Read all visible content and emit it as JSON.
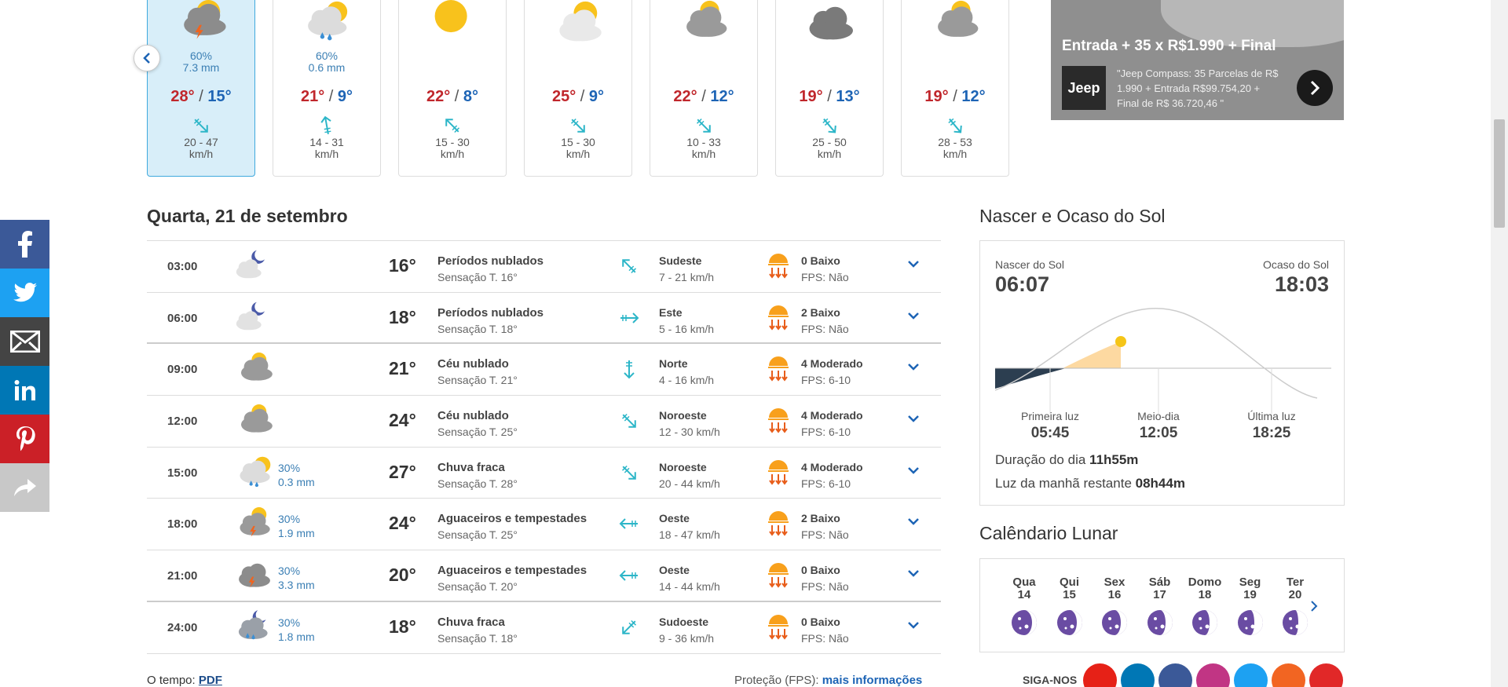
{
  "forecast_days": [
    {
      "rain_prob": "60%",
      "rain_mm": "7.3 mm",
      "max": "28°",
      "min": "15°",
      "wind": "20 - 47",
      "unit": "km/h",
      "icon": "thunderstorm-icon"
    },
    {
      "rain_prob": "60%",
      "rain_mm": "0.6 mm",
      "max": "21°",
      "min": "9°",
      "wind": "14 - 31",
      "unit": "km/h",
      "icon": "sun-rain-icon"
    },
    {
      "rain_prob": "",
      "rain_mm": "",
      "max": "22°",
      "min": "8°",
      "wind": "15 - 30",
      "unit": "km/h",
      "icon": "sun-icon"
    },
    {
      "rain_prob": "",
      "rain_mm": "",
      "max": "25°",
      "min": "9°",
      "wind": "15 - 30",
      "unit": "km/h",
      "icon": "sun-cloud-icon"
    },
    {
      "rain_prob": "",
      "rain_mm": "",
      "max": "22°",
      "min": "12°",
      "wind": "10 - 33",
      "unit": "km/h",
      "icon": "cloudy-icon"
    },
    {
      "rain_prob": "",
      "rain_mm": "",
      "max": "19°",
      "min": "13°",
      "wind": "25 - 50",
      "unit": "km/h",
      "icon": "overcast-icon"
    },
    {
      "rain_prob": "",
      "rain_mm": "",
      "max": "19°",
      "min": "12°",
      "wind": "28 - 53",
      "unit": "km/h",
      "icon": "cloudy-icon"
    }
  ],
  "ad": {
    "headline": "Entrada + 35 x R$1.990 + Final",
    "logo": "Jeep",
    "text": "\"Jeep Compass: 35 Parcelas de R$ 1.990 + Entrada R$99.754,20 + Final de R$ 36.720,46 \""
  },
  "day_title": "Quarta, 21 de setembro",
  "hours": [
    {
      "time": "03:00",
      "prob": "",
      "mm": "",
      "temp": "16°",
      "cond": "Períodos nublados",
      "feel": "Sensação T. 16°",
      "wind_dir": "Sudeste",
      "wind": "7 - 21 km/h",
      "uv": "0 Baixo",
      "fps": "FPS: Não",
      "icon": "night-cloud-icon"
    },
    {
      "time": "06:00",
      "prob": "",
      "mm": "",
      "temp": "18°",
      "cond": "Períodos nublados",
      "feel": "Sensação T. 18°",
      "wind_dir": "Este",
      "wind": "5 - 16 km/h",
      "uv": "2 Baixo",
      "fps": "FPS: Não",
      "icon": "night-cloud-icon"
    },
    {
      "time": "09:00",
      "prob": "",
      "mm": "",
      "temp": "21°",
      "cond": "Céu nublado",
      "feel": "Sensação T. 21°",
      "wind_dir": "Norte",
      "wind": "4 - 16 km/h",
      "uv": "4 Moderado",
      "fps": "FPS: 6-10",
      "icon": "cloudy-icon"
    },
    {
      "time": "12:00",
      "prob": "",
      "mm": "",
      "temp": "24°",
      "cond": "Céu nublado",
      "feel": "Sensação T. 25°",
      "wind_dir": "Noroeste",
      "wind": "12 - 30 km/h",
      "uv": "4 Moderado",
      "fps": "FPS: 6-10",
      "icon": "cloudy-icon"
    },
    {
      "time": "15:00",
      "prob": "30%",
      "mm": "0.3 mm",
      "temp": "27°",
      "cond": "Chuva fraca",
      "feel": "Sensação T. 28°",
      "wind_dir": "Noroeste",
      "wind": "20 - 44 km/h",
      "uv": "4 Moderado",
      "fps": "FPS: 6-10",
      "icon": "sun-rain-icon"
    },
    {
      "time": "18:00",
      "prob": "30%",
      "mm": "1.9 mm",
      "temp": "24°",
      "cond": "Aguaceiros e tempestades",
      "feel": "Sensação T. 25°",
      "wind_dir": "Oeste",
      "wind": "18 - 47 km/h",
      "uv": "2 Baixo",
      "fps": "FPS: Não",
      "icon": "sun-storm-icon"
    },
    {
      "time": "21:00",
      "prob": "30%",
      "mm": "3.3 mm",
      "temp": "20°",
      "cond": "Aguaceiros e tempestades",
      "feel": "Sensação T. 20°",
      "wind_dir": "Oeste",
      "wind": "14 - 44 km/h",
      "uv": "0 Baixo",
      "fps": "FPS: Não",
      "icon": "storm-icon"
    },
    {
      "time": "24:00",
      "prob": "30%",
      "mm": "1.8 mm",
      "temp": "18°",
      "cond": "Chuva fraca",
      "feel": "Sensação T. 18°",
      "wind_dir": "Sudoeste",
      "wind": "9 - 36 km/h",
      "uv": "0 Baixo",
      "fps": "FPS: Não",
      "icon": "night-rain-icon"
    }
  ],
  "footer": {
    "tempo_label": "O tempo:",
    "pdf": "PDF",
    "fps_label": "Proteção (FPS):",
    "fps_link": "mais informações"
  },
  "sun": {
    "title": "Nascer e Ocaso do Sol",
    "sunrise_label": "Nascer do Sol",
    "sunrise": "06:07",
    "sunset_label": "Ocaso do Sol",
    "sunset": "18:03",
    "first_light_label": "Primeira luz",
    "first_light": "05:45",
    "noon_label": "Meio-dia",
    "noon": "12:05",
    "last_light_label": "Última luz",
    "last_light": "18:25",
    "duration_label": "Duração do dia",
    "duration": "11h55m",
    "remaining_label": "Luz da manhã restante",
    "remaining": "08h44m"
  },
  "moon": {
    "title": "Calêndario Lunar",
    "days": [
      {
        "day": "Qua",
        "num": "14"
      },
      {
        "day": "Qui",
        "num": "15"
      },
      {
        "day": "Sex",
        "num": "16"
      },
      {
        "day": "Sáb",
        "num": "17"
      },
      {
        "day": "Domo",
        "num": "18"
      },
      {
        "day": "Seg",
        "num": "19"
      },
      {
        "day": "Ter",
        "num": "20"
      }
    ]
  },
  "follow": {
    "label": "SIGA-NOS"
  },
  "colors": {
    "accent": "#1d64b5",
    "max": "#c0262b",
    "active_bg": "#d8eef9"
  }
}
